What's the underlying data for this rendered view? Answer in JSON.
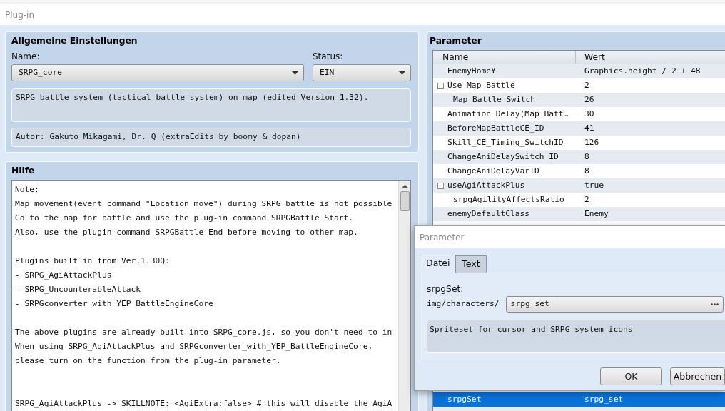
{
  "window": {
    "title": "Plug-in"
  },
  "general": {
    "title": "Allgemeine Einstellungen",
    "name_label": "Name:",
    "name_value": "SRPG_core",
    "status_label": "Status:",
    "status_value": "EIN",
    "description": "SRPG battle system (tactical battle system) on map (edited Version 1.32).",
    "author": "Autor: Gakuto Mikagami, Dr. Q (extraEdits by boomy & dopan)"
  },
  "help": {
    "title": "Hilfe",
    "text": "Note:\nMap movement(event command \"Location move\") during SRPG battle is not possible\nGo to the map for battle and use the plug-in command SRPGBattle Start.\nAlso, use the plugin command SRPGBattle End before moving to other map.\n\nPlugins built in from Ver.1.30Q:\n- SRPG_AgiAttackPlus\n- SRPG_UncounterableAttack\n- SRPGconverter_with_YEP_BattleEngineCore\n\nThe above plugins are already built into SRPG_core.js, so you don't need to in\nWhen using SRPG_AgiAttackPlus and SRPGconverter_with_YEP_BattleEngineCore,\nplease turn on the function from the plug-in parameter.\n\n\nSRPG_AgiAttackPlus -> SKILLNOTE: <AgiExtra:false> # this will disable the AgiA"
  },
  "parameters": {
    "title": "Parameter",
    "columns": [
      "Name",
      "Wert"
    ],
    "rows": [
      {
        "name": "EnemyHomeY",
        "value": "Graphics.height / 2 + 48",
        "selected": false
      },
      {
        "name": "Use Map Battle",
        "value": "2",
        "selected": false,
        "expanded": true,
        "children": [
          {
            "name": "Map Battle Switch",
            "value": "26",
            "selected": false
          }
        ]
      },
      {
        "name": "Animation Delay(Map Batt…",
        "value": "30",
        "selected": false
      },
      {
        "name": "BeforeMapBattleCE_ID",
        "value": "41",
        "selected": false
      },
      {
        "name": "Skill_CE_Timing_SwitchID",
        "value": "126",
        "selected": false
      },
      {
        "name": "ChangeAniDelaySwitch_ID",
        "value": "8",
        "selected": false
      },
      {
        "name": "ChangeAniDelayVarID",
        "value": "8",
        "selected": false
      },
      {
        "name": "useAgiAttackPlus",
        "value": "true",
        "selected": false,
        "expanded": true,
        "children": [
          {
            "name": "srpgAgilityAffectsRatio",
            "value": "2",
            "selected": false
          }
        ]
      },
      {
        "name": "enemyDefaultClass",
        "value": "Enemy",
        "selected": false
      }
    ],
    "lower_rows": [
      {
        "name": "srpgSet",
        "value": "srpg_set",
        "selected": true
      }
    ]
  },
  "dialog": {
    "title": "Parameter",
    "tabs": [
      {
        "label": "Datei",
        "selected": true
      },
      {
        "label": "Text",
        "selected": false
      }
    ],
    "field_label": "srpgSet:",
    "path_prefix": "img/characters/",
    "file_value": "srpg_set",
    "description": "Spriteset for cursor and SRPG system icons",
    "buttons": [
      "OK",
      "Abbrechen"
    ]
  }
}
